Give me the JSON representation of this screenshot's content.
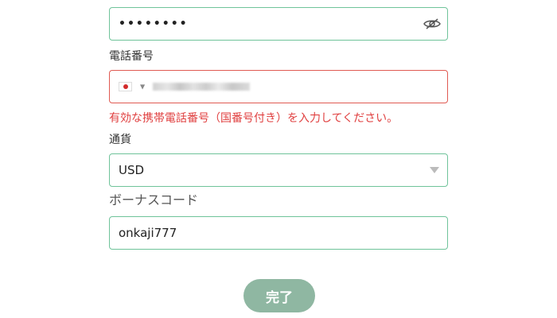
{
  "password": {
    "masked_value": "••••••••",
    "toggle_icon": "eye-slash-icon"
  },
  "phone": {
    "label": "電話番号",
    "country_flag": "japan-flag-icon",
    "error_message": "有効な携帯電話番号（国番号付き）を入力してください。",
    "error_color": "#e04040"
  },
  "currency": {
    "label": "通貨",
    "selected": "USD"
  },
  "bonus_code": {
    "label": "ボーナスコード",
    "value": "onkaji777"
  },
  "submit": {
    "label": "完了",
    "color": "#8fb7a2"
  },
  "colors": {
    "valid_border": "#6fc39a",
    "error_border": "#e05a52"
  }
}
